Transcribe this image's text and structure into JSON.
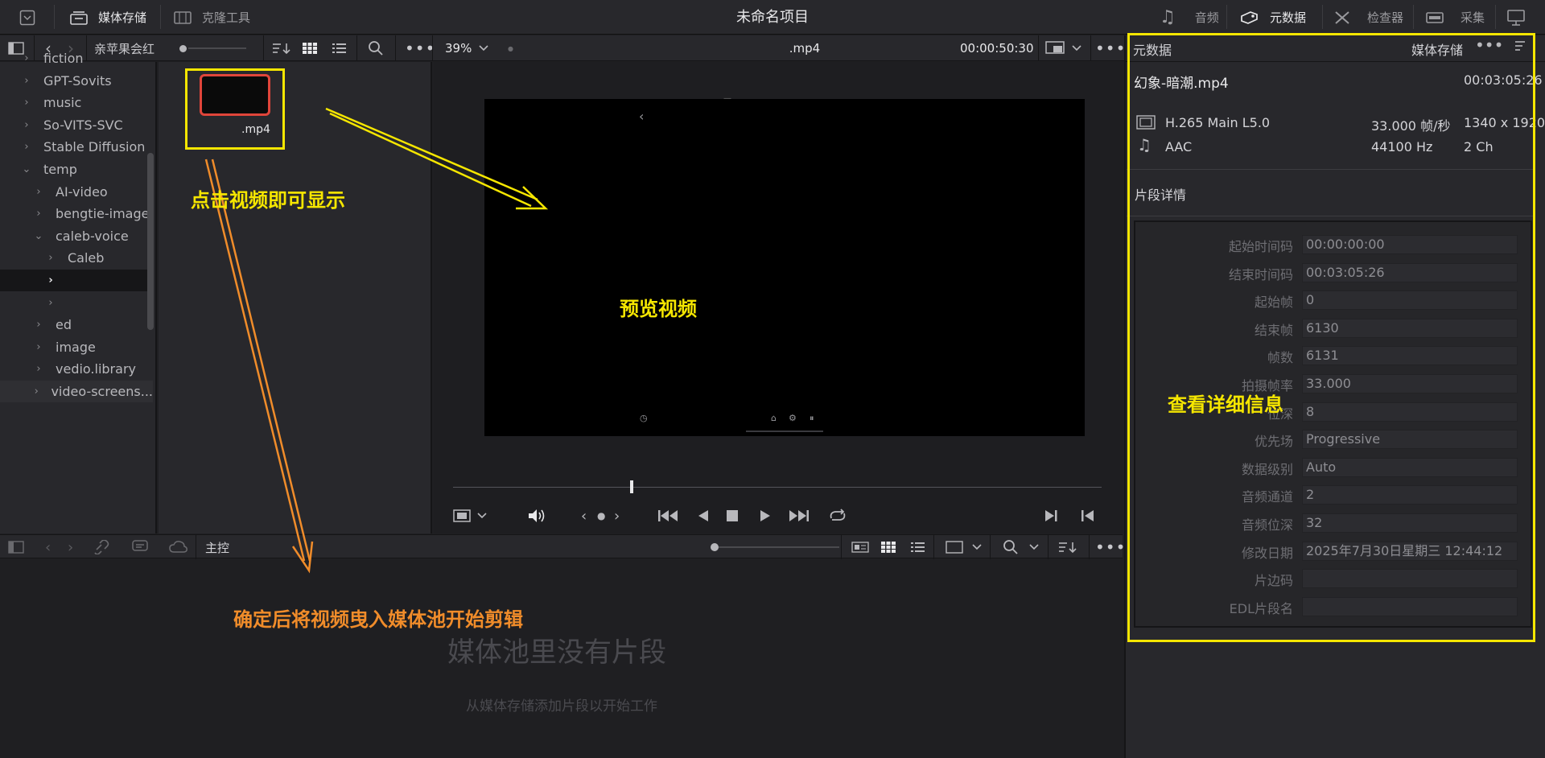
{
  "app": {
    "project_title": "未命名项目",
    "top_tabs": [
      "媒体存储",
      "克隆工具"
    ],
    "right_tabs": [
      "音频",
      "元数据",
      "检查器",
      "采集"
    ]
  },
  "toolbar": {
    "folder_name": "亲苹果会红",
    "zoom": "39%",
    "clip_name": ".mp4",
    "timecode": "00:00:50:30",
    "meta_title": "元数据",
    "meta_source": "媒体存储"
  },
  "tree": {
    "items": [
      {
        "label": "fiction",
        "indent": 0,
        "chev": "›"
      },
      {
        "label": "GPT-Sovits",
        "indent": 0,
        "chev": "›"
      },
      {
        "label": "music",
        "indent": 0,
        "chev": "›"
      },
      {
        "label": "So-VITS-SVC",
        "indent": 0,
        "chev": "›"
      },
      {
        "label": "Stable Diffusion",
        "indent": 0,
        "chev": "›"
      },
      {
        "label": "temp",
        "indent": 0,
        "chev": "⌄"
      },
      {
        "label": "AI-video",
        "indent": 1,
        "chev": "›"
      },
      {
        "label": "bengtie-image",
        "indent": 1,
        "chev": "›"
      },
      {
        "label": "caleb-voice",
        "indent": 1,
        "chev": "⌄"
      },
      {
        "label": "Caleb",
        "indent": 2,
        "chev": "›"
      },
      {
        "label": "",
        "indent": 2,
        "chev": "›",
        "selected": true
      },
      {
        "label": "",
        "indent": 2,
        "chev": "›"
      },
      {
        "label": "ed",
        "indent": 1,
        "chev": "›"
      },
      {
        "label": "image",
        "indent": 1,
        "chev": "›"
      },
      {
        "label": "vedio.library",
        "indent": 1,
        "chev": "›"
      },
      {
        "label": "video-screens...",
        "indent": 1,
        "chev": "›"
      }
    ]
  },
  "media": {
    "thumb_label": ".mp4"
  },
  "pool": {
    "label": "主控",
    "empty_title": "媒体池里没有片段",
    "empty_subtitle": "从媒体存储添加片段以开始工作"
  },
  "meta": {
    "file_name": "幻象-暗潮.mp4",
    "duration": "00:03:05:26",
    "video_codec": "H.265 Main L5.0",
    "frame_rate": "33.000 帧/秒",
    "resolution": "1340 x 1920",
    "audio_codec": "AAC",
    "sample_rate": "44100 Hz",
    "channels": "2 Ch",
    "section_title": "片段详情",
    "fields": [
      {
        "label": "起始时间码",
        "value": "00:00:00:00"
      },
      {
        "label": "结束时间码",
        "value": "00:03:05:26"
      },
      {
        "label": "起始帧",
        "value": "0"
      },
      {
        "label": "结束帧",
        "value": "6130"
      },
      {
        "label": "帧数",
        "value": "6131"
      },
      {
        "label": "拍摄帧率",
        "value": "33.000"
      },
      {
        "label": "位深",
        "value": "8"
      },
      {
        "label": "优先场",
        "value": "Progressive"
      },
      {
        "label": "数据级别",
        "value": "Auto"
      },
      {
        "label": "音频通道",
        "value": "2"
      },
      {
        "label": "音频位深",
        "value": "32"
      },
      {
        "label": "修改日期",
        "value": "2025年7月30日星期三 12:44:12"
      },
      {
        "label": "片边码",
        "value": ""
      },
      {
        "label": "EDL片段名",
        "value": ""
      }
    ]
  },
  "annotations": {
    "click_to_show": "点击视频即可显示",
    "preview": "预览视频",
    "view_details": "查看详细信息",
    "drag_to_pool": "确定后将视频曳入媒体池开始剪辑"
  },
  "colors": {
    "highlight_yellow": "#f5e600",
    "arrow_orange": "#f08c2a",
    "thumb_border": "#e0453a"
  }
}
